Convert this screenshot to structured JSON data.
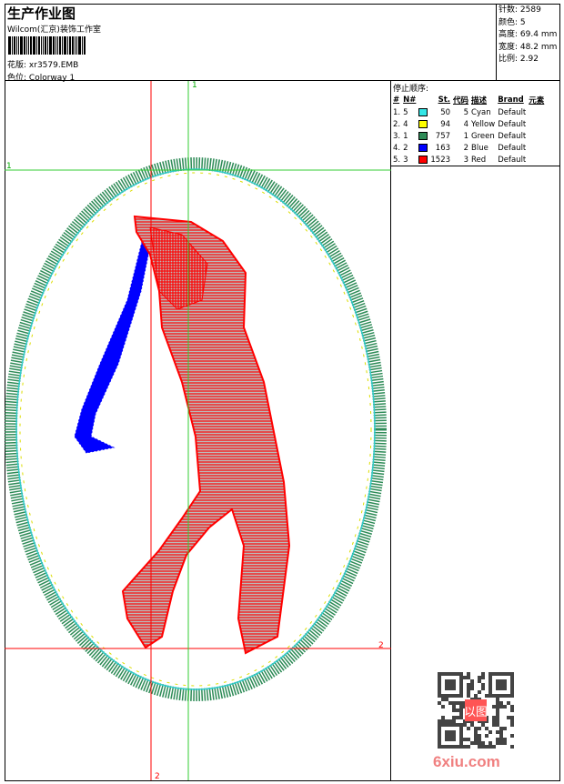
{
  "header": {
    "title": "生产作业图",
    "subtitle": "Wilcom(汇京)装饰工作室",
    "design_label": "花版:",
    "design_value": "xr3579.EMB",
    "colorway_label": "色位:",
    "colorway_value": "Colorway 1"
  },
  "info": [
    {
      "label": "针数:",
      "value": "2589"
    },
    {
      "label": "颜色:",
      "value": "5"
    },
    {
      "label": "高度:",
      "value": "69.4 mm"
    },
    {
      "label": "宽度:",
      "value": "48.2 mm"
    },
    {
      "label": "比例:",
      "value": "2.92"
    }
  ],
  "stop_sequence": {
    "title": "停止顺序:",
    "columns": [
      "#",
      "N#",
      "",
      "St.",
      "代码",
      "描述",
      "Brand",
      "元素"
    ],
    "rows": [
      {
        "idx": "1.",
        "n": "5",
        "color": "#33e6e6",
        "st": "50",
        "code": "5",
        "desc": "Cyan",
        "brand": "Default"
      },
      {
        "idx": "2.",
        "n": "4",
        "color": "#ffff00",
        "st": "94",
        "code": "4",
        "desc": "Yellow",
        "brand": "Default"
      },
      {
        "idx": "3.",
        "n": "1",
        "color": "#2e8b57",
        "st": "757",
        "code": "1",
        "desc": "Green",
        "brand": "Default"
      },
      {
        "idx": "4.",
        "n": "2",
        "color": "#0000ff",
        "st": "163",
        "code": "2",
        "desc": "Blue",
        "brand": "Default"
      },
      {
        "idx": "5.",
        "n": "3",
        "color": "#ff0000",
        "st": "1523",
        "code": "3",
        "desc": "Red",
        "brand": "Default"
      }
    ]
  },
  "guides": {
    "green_label": "1",
    "red_label": "2"
  },
  "watermark": "6xiu.com",
  "qr_seal": "以图版"
}
